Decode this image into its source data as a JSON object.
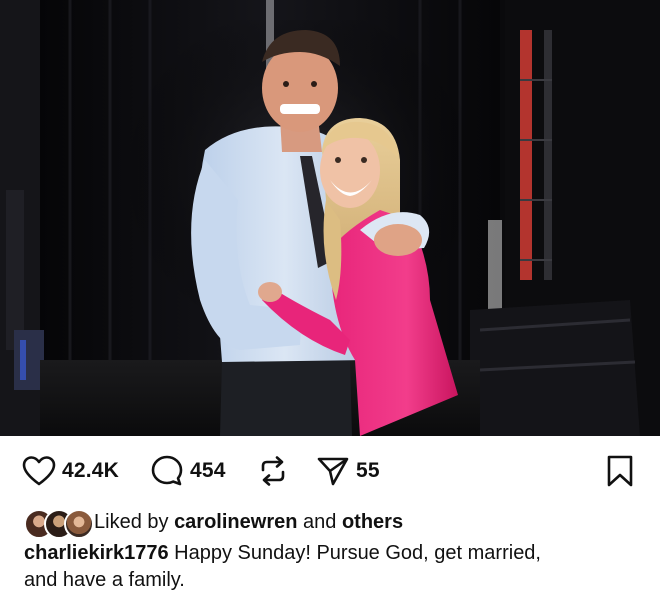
{
  "post": {
    "photo": {
      "description_icon": "photo"
    },
    "actions": {
      "likes": "42.4K",
      "comments": "454",
      "shares": "55"
    },
    "liked_by": {
      "prefix": "Liked by",
      "user": "carolinewren",
      "joiner": "and",
      "suffix": "others"
    },
    "caption": {
      "username": "charliekirk1776",
      "text": "Happy Sunday! Pursue God, get married,\nand have a family."
    }
  },
  "colors": {
    "accent_pink": "#e8257a",
    "icon": "#111111",
    "background": "#ffffff"
  }
}
